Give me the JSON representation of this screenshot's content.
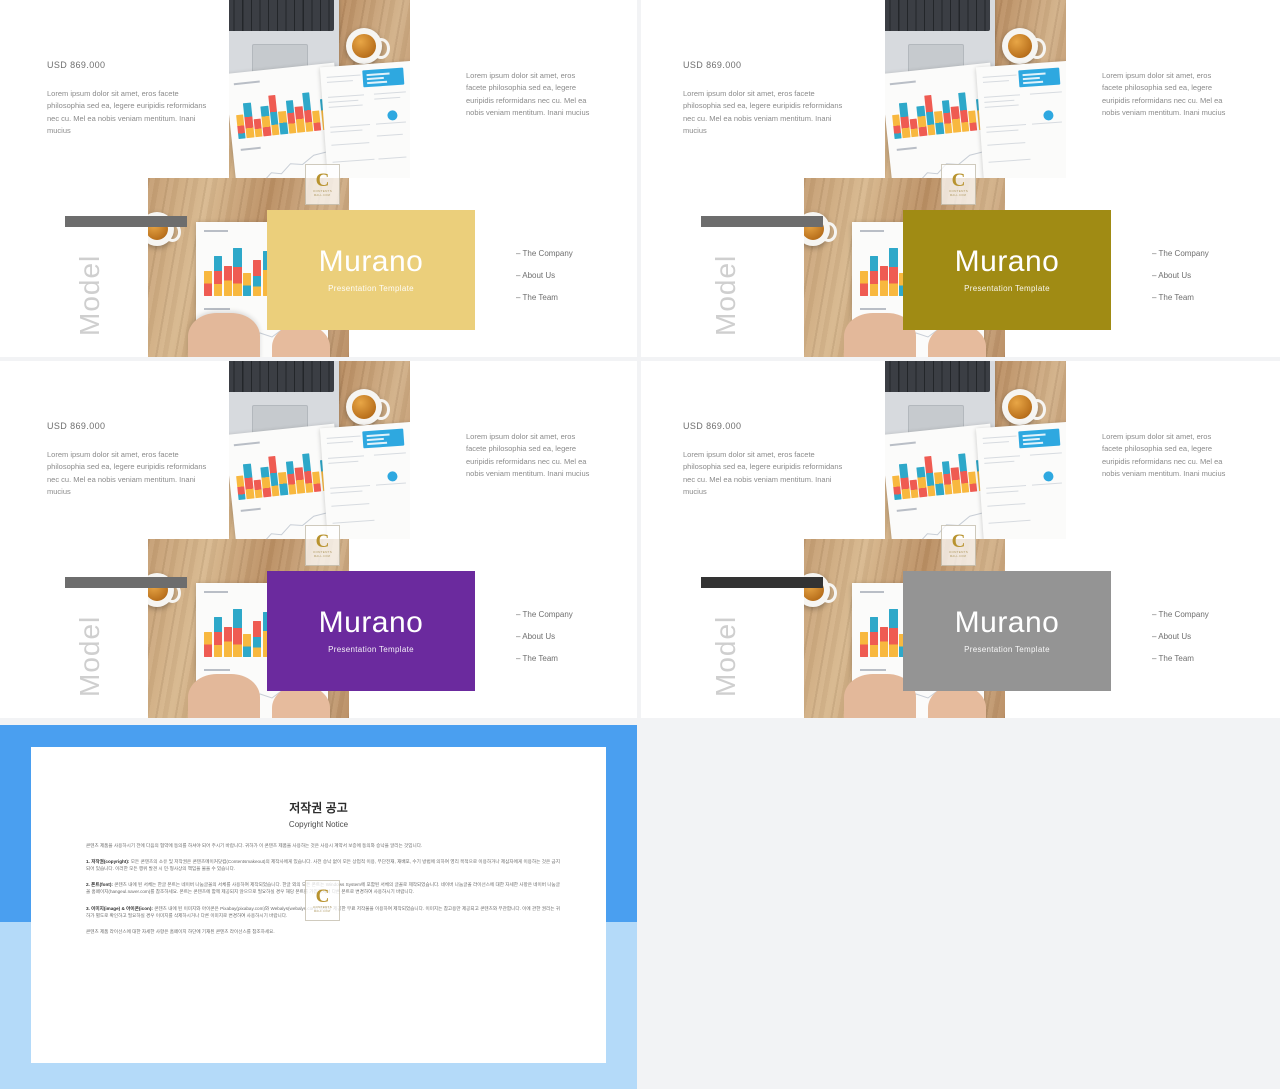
{
  "page": {
    "background": "#f2f3f5",
    "gap_color": "#f2f3f5",
    "slide_count": 5
  },
  "slide_common": {
    "price_label": "USD 869.000",
    "left_paragraph": "Lorem ipsum dolor sit amet, eros facete philosophia sed ea, legere euripidis reformidans nec cu. Mel ea nobis veniam mentitum. Inani mucius",
    "right_paragraph": "Lorem ipsum dolor sit amet, eros facete philosophia sed ea, legere euripidis reformidans nec cu. Mel ea nobis veniam mentitum. Inani mucius",
    "model_word": "Model",
    "card_title": "Murano",
    "card_subtitle": "Presentation Template",
    "menu_items": [
      "– The Company",
      "– About  Us",
      "– The Team"
    ],
    "watermark": {
      "letter": "C",
      "line1": "CONTENTS",
      "line2": "MALL.COM"
    }
  },
  "slides": [
    {
      "index": 1,
      "name": "slide-yellow",
      "card_color": "#ebcf7b",
      "bar_color": "#6d6d6d",
      "title_color": "#ffffff"
    },
    {
      "index": 2,
      "name": "slide-olive",
      "card_color": "#a08b14",
      "bar_color": "#6d6d6d",
      "title_color": "#ffffff"
    },
    {
      "index": 3,
      "name": "slide-purple",
      "card_color": "#6b2a9e",
      "bar_color": "#6d6d6d",
      "title_color": "#ffffff"
    },
    {
      "index": 4,
      "name": "slide-gray",
      "card_color": "#949494",
      "bar_color": "#333333",
      "title_color": "#ffffff"
    }
  ],
  "copyright_slide": {
    "name": "copyright-notice-slide",
    "frame_color_top": "#4a9ff0",
    "frame_color_bottom": "#b4daf9",
    "title_ko": "저작권 공고",
    "title_en": "Copyright Notice",
    "paragraphs": [
      {
        "lead": "",
        "text": "콘텐츠 제품을 사용하시기 전에 다음의 협약에 동의를 하셔야 되어 주시기 바랍니다. 귀하가 이 콘텐츠 제품을 사용하는 것은 사용시 계약서 보증에 동의와 승낙을 알리는 것입니다."
      },
      {
        "lead": "1. 저작권(copyright):",
        "text": "모든 콘텐츠의 소유 및 저작권은 콘텐츠메이커닷컴(Contentsmakeout)의 제작사에게 있습니다. 사전 승낙 없이 모든 상업적 이용, 무단전재, 재배포, 수기 방법에 의하여 영리 목적으로 이용하거나 제삼자에게 이용하는 것은 금지되어 있습니다. 이러한 모든 행위 발견 시 민·형사상의 책임을 물을 수 있습니다."
      },
      {
        "lead": "2. 폰트(font):",
        "text": "콘텐츠 내에 된 서체는 한글 폰트는 네이버 나눔글꼴의 서체를 사용하여 제작되었습니다. 한글 외의 모든 폰트는 Windows System에 포함된 서체의 글꼴로 제작되었습니다. 네이버 나눔글꼴 라이선스에 대한 자세한 사항은 네이버 나눔글꼴 홈페이지(hangeul.naver.com)를 참조하세요. 폰트는 콘텐츠에 함께 제공되지 않으므로 필요하실 경우 해당 폰트를 가입하셔서 다른 폰트로 변경하여 사용하시기 바랍니다."
      },
      {
        "lead": "3. 이미지(image) & 아이콘(icon):",
        "text": "콘텐츠 내에 된 이미지와 아이콘은 Pixabay(pixabay.com)와 Webalys(webalys.com) 등에서 제공한 무료 저작물을 이용하여 제작되었습니다. 이미지는 참고용만 제공되고 콘텐츠와 무관합니다. 이에 관한 권리는 귀하가 별도로 확인하고 필요하실 경우 이미지를 삭제하시거나 다른 이미지로 변경하여 사용하시기 바랍니다."
      },
      {
        "lead": "",
        "text": "콘텐츠 제품 라이선스에 대한 자세한 사항은 홈페이지 하단에 기재된 콘텐츠 라이선스를 참조하세요."
      }
    ]
  }
}
